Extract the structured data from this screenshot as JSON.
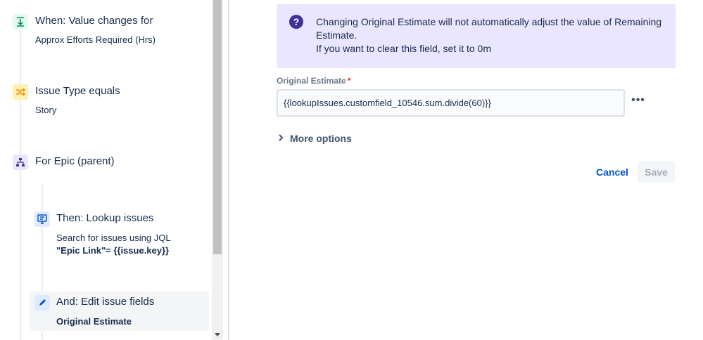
{
  "rules": [
    {
      "title": "When: Value changes for",
      "subtitle": "Approx Efforts Required (Hrs)",
      "icon": "trigger-icon",
      "icon_bg": "#e3fcef",
      "icon_color": "#00875a"
    },
    {
      "title": "Issue Type equals",
      "subtitle": "Story",
      "icon": "condition-icon",
      "icon_bg": "#fff0b3",
      "icon_color": "#ff8b00"
    },
    {
      "title": "For Epic (parent)",
      "icon": "branch-icon",
      "icon_bg": "#eae6ff",
      "icon_color": "#403294"
    },
    {
      "title": "Then: Lookup issues",
      "subtitle": "Search for issues using JQL",
      "subtitle2_bold": "\"Epic Link\"",
      "subtitle2_rest": "= {{issue.key}}",
      "icon": "lookup-icon",
      "icon_bg": "#deebff",
      "icon_color": "#0052cc"
    },
    {
      "title": "And: Edit issue fields",
      "subtitle": "Original Estimate",
      "icon": "edit-icon",
      "icon_bg": "#deebff",
      "icon_color": "#0052cc"
    }
  ],
  "banner": {
    "icon": "question-icon",
    "line1": "Changing Original Estimate will not automatically adjust the value of Remaining Estimate.",
    "line2": "If you want to clear this field, set it to 0m"
  },
  "field": {
    "label": "Original Estimate",
    "required_mark": "*",
    "value": "{{lookupIssues.customfield_10546.sum.divide(60)}}"
  },
  "more_menu_label": "•••",
  "more_options_label": "More options",
  "buttons": {
    "cancel": "Cancel",
    "save": "Save"
  },
  "colors": {
    "link": "#0052cc",
    "banner_bg": "#eae6ff",
    "banner_icon": "#403294"
  }
}
